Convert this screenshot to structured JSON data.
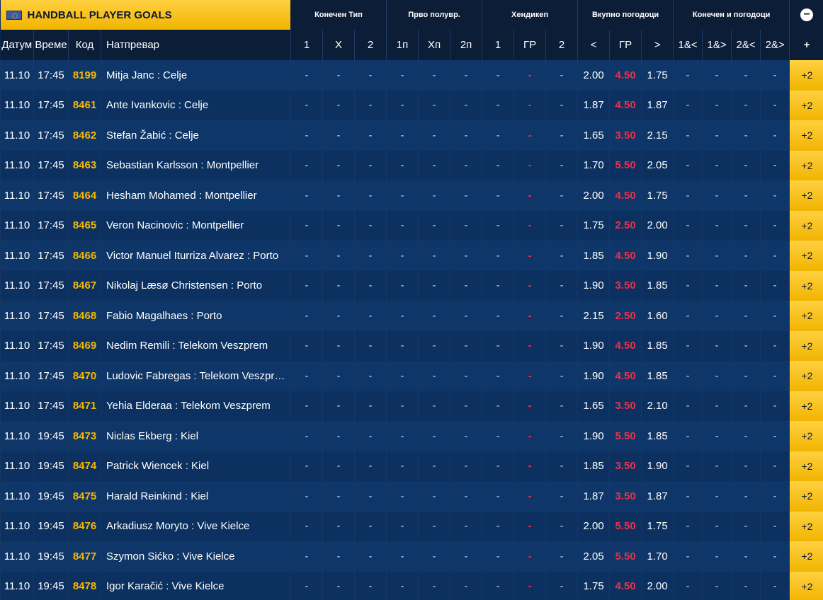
{
  "header": {
    "title": "HANDBALL PLAYER GOALS",
    "groups": [
      "Конечен Тип",
      "Прво полувр.",
      "Хендикеп",
      "Вкупно погодоци",
      "Конечен и погодоци"
    ],
    "collapse_icon": "minus-circle-icon",
    "columns": {
      "date": "Датум",
      "time": "Време",
      "code": "Код",
      "match": "Натпревар",
      "ft": [
        "1",
        "X",
        "2"
      ],
      "ht": [
        "1п",
        "Xп",
        "2п"
      ],
      "hcp": [
        "1",
        "ГР",
        "2"
      ],
      "total": [
        "<",
        "ГР",
        ">"
      ],
      "combo": [
        "1&<",
        "1&>",
        "2&<",
        "2&>"
      ],
      "plus": "+"
    }
  },
  "colors": {
    "accent": "#f5b800",
    "handicap_value": "#e8324a",
    "background": "#0b2a55"
  },
  "rows": [
    {
      "date": "11.10",
      "time": "17:45",
      "code": "8199",
      "match": "Mitja Janc : Celje",
      "ft": [
        "-",
        "-",
        "-"
      ],
      "ht": [
        "-",
        "-",
        "-"
      ],
      "hcp": [
        "-",
        "-",
        "-"
      ],
      "under": "2.00",
      "gr": "4.50",
      "over": "1.75",
      "combo": [
        "-",
        "-",
        "-",
        "-"
      ],
      "more": "+2"
    },
    {
      "date": "11.10",
      "time": "17:45",
      "code": "8461",
      "match": "Ante Ivankovic : Celje",
      "ft": [
        "-",
        "-",
        "-"
      ],
      "ht": [
        "-",
        "-",
        "-"
      ],
      "hcp": [
        "-",
        "-",
        "-"
      ],
      "under": "1.87",
      "gr": "4.50",
      "over": "1.87",
      "combo": [
        "-",
        "-",
        "-",
        "-"
      ],
      "more": "+2"
    },
    {
      "date": "11.10",
      "time": "17:45",
      "code": "8462",
      "match": "Stefan Žabić : Celje",
      "ft": [
        "-",
        "-",
        "-"
      ],
      "ht": [
        "-",
        "-",
        "-"
      ],
      "hcp": [
        "-",
        "-",
        "-"
      ],
      "under": "1.65",
      "gr": "3.50",
      "over": "2.15",
      "combo": [
        "-",
        "-",
        "-",
        "-"
      ],
      "more": "+2"
    },
    {
      "date": "11.10",
      "time": "17:45",
      "code": "8463",
      "match": "Sebastian Karlsson : Montpellier",
      "ft": [
        "-",
        "-",
        "-"
      ],
      "ht": [
        "-",
        "-",
        "-"
      ],
      "hcp": [
        "-",
        "-",
        "-"
      ],
      "under": "1.70",
      "gr": "5.50",
      "over": "2.05",
      "combo": [
        "-",
        "-",
        "-",
        "-"
      ],
      "more": "+2"
    },
    {
      "date": "11.10",
      "time": "17:45",
      "code": "8464",
      "match": "Hesham Mohamed : Montpellier",
      "ft": [
        "-",
        "-",
        "-"
      ],
      "ht": [
        "-",
        "-",
        "-"
      ],
      "hcp": [
        "-",
        "-",
        "-"
      ],
      "under": "2.00",
      "gr": "4.50",
      "over": "1.75",
      "combo": [
        "-",
        "-",
        "-",
        "-"
      ],
      "more": "+2"
    },
    {
      "date": "11.10",
      "time": "17:45",
      "code": "8465",
      "match": "Veron Nacinovic : Montpellier",
      "ft": [
        "-",
        "-",
        "-"
      ],
      "ht": [
        "-",
        "-",
        "-"
      ],
      "hcp": [
        "-",
        "-",
        "-"
      ],
      "under": "1.75",
      "gr": "2.50",
      "over": "2.00",
      "combo": [
        "-",
        "-",
        "-",
        "-"
      ],
      "more": "+2"
    },
    {
      "date": "11.10",
      "time": "17:45",
      "code": "8466",
      "match": "Victor Manuel Iturriza Alvarez : Porto",
      "ft": [
        "-",
        "-",
        "-"
      ],
      "ht": [
        "-",
        "-",
        "-"
      ],
      "hcp": [
        "-",
        "-",
        "-"
      ],
      "under": "1.85",
      "gr": "4.50",
      "over": "1.90",
      "combo": [
        "-",
        "-",
        "-",
        "-"
      ],
      "more": "+2"
    },
    {
      "date": "11.10",
      "time": "17:45",
      "code": "8467",
      "match": "Nikolaj Læsø Christensen : Porto",
      "ft": [
        "-",
        "-",
        "-"
      ],
      "ht": [
        "-",
        "-",
        "-"
      ],
      "hcp": [
        "-",
        "-",
        "-"
      ],
      "under": "1.90",
      "gr": "3.50",
      "over": "1.85",
      "combo": [
        "-",
        "-",
        "-",
        "-"
      ],
      "more": "+2"
    },
    {
      "date": "11.10",
      "time": "17:45",
      "code": "8468",
      "match": "Fabio Magalhaes : Porto",
      "ft": [
        "-",
        "-",
        "-"
      ],
      "ht": [
        "-",
        "-",
        "-"
      ],
      "hcp": [
        "-",
        "-",
        "-"
      ],
      "under": "2.15",
      "gr": "2.50",
      "over": "1.60",
      "combo": [
        "-",
        "-",
        "-",
        "-"
      ],
      "more": "+2"
    },
    {
      "date": "11.10",
      "time": "17:45",
      "code": "8469",
      "match": "Nedim Remili : Telekom Veszprem",
      "ft": [
        "-",
        "-",
        "-"
      ],
      "ht": [
        "-",
        "-",
        "-"
      ],
      "hcp": [
        "-",
        "-",
        "-"
      ],
      "under": "1.90",
      "gr": "4.50",
      "over": "1.85",
      "combo": [
        "-",
        "-",
        "-",
        "-"
      ],
      "more": "+2"
    },
    {
      "date": "11.10",
      "time": "17:45",
      "code": "8470",
      "match": "Ludovic Fabregas : Telekom Veszpr…",
      "ft": [
        "-",
        "-",
        "-"
      ],
      "ht": [
        "-",
        "-",
        "-"
      ],
      "hcp": [
        "-",
        "-",
        "-"
      ],
      "under": "1.90",
      "gr": "4.50",
      "over": "1.85",
      "combo": [
        "-",
        "-",
        "-",
        "-"
      ],
      "more": "+2"
    },
    {
      "date": "11.10",
      "time": "17:45",
      "code": "8471",
      "match": "Yehia Elderaa : Telekom Veszprem",
      "ft": [
        "-",
        "-",
        "-"
      ],
      "ht": [
        "-",
        "-",
        "-"
      ],
      "hcp": [
        "-",
        "-",
        "-"
      ],
      "under": "1.65",
      "gr": "3.50",
      "over": "2.10",
      "combo": [
        "-",
        "-",
        "-",
        "-"
      ],
      "more": "+2"
    },
    {
      "date": "11.10",
      "time": "19:45",
      "code": "8473",
      "match": "Niclas Ekberg : Kiel",
      "ft": [
        "-",
        "-",
        "-"
      ],
      "ht": [
        "-",
        "-",
        "-"
      ],
      "hcp": [
        "-",
        "-",
        "-"
      ],
      "under": "1.90",
      "gr": "5.50",
      "over": "1.85",
      "combo": [
        "-",
        "-",
        "-",
        "-"
      ],
      "more": "+2"
    },
    {
      "date": "11.10",
      "time": "19:45",
      "code": "8474",
      "match": "Patrick Wiencek : Kiel",
      "ft": [
        "-",
        "-",
        "-"
      ],
      "ht": [
        "-",
        "-",
        "-"
      ],
      "hcp": [
        "-",
        "-",
        "-"
      ],
      "under": "1.85",
      "gr": "3.50",
      "over": "1.90",
      "combo": [
        "-",
        "-",
        "-",
        "-"
      ],
      "more": "+2"
    },
    {
      "date": "11.10",
      "time": "19:45",
      "code": "8475",
      "match": "Harald Reinkind : Kiel",
      "ft": [
        "-",
        "-",
        "-"
      ],
      "ht": [
        "-",
        "-",
        "-"
      ],
      "hcp": [
        "-",
        "-",
        "-"
      ],
      "under": "1.87",
      "gr": "3.50",
      "over": "1.87",
      "combo": [
        "-",
        "-",
        "-",
        "-"
      ],
      "more": "+2"
    },
    {
      "date": "11.10",
      "time": "19:45",
      "code": "8476",
      "match": "Arkadiusz Moryto : Vive Kielce",
      "ft": [
        "-",
        "-",
        "-"
      ],
      "ht": [
        "-",
        "-",
        "-"
      ],
      "hcp": [
        "-",
        "-",
        "-"
      ],
      "under": "2.00",
      "gr": "5.50",
      "over": "1.75",
      "combo": [
        "-",
        "-",
        "-",
        "-"
      ],
      "more": "+2"
    },
    {
      "date": "11.10",
      "time": "19:45",
      "code": "8477",
      "match": "Szymon Sićko : Vive Kielce",
      "ft": [
        "-",
        "-",
        "-"
      ],
      "ht": [
        "-",
        "-",
        "-"
      ],
      "hcp": [
        "-",
        "-",
        "-"
      ],
      "under": "2.05",
      "gr": "5.50",
      "over": "1.70",
      "combo": [
        "-",
        "-",
        "-",
        "-"
      ],
      "more": "+2"
    },
    {
      "date": "11.10",
      "time": "19:45",
      "code": "8478",
      "match": "Igor Karačić : Vive Kielce",
      "ft": [
        "-",
        "-",
        "-"
      ],
      "ht": [
        "-",
        "-",
        "-"
      ],
      "hcp": [
        "-",
        "-",
        "-"
      ],
      "under": "1.75",
      "gr": "4.50",
      "over": "2.00",
      "combo": [
        "-",
        "-",
        "-",
        "-"
      ],
      "more": "+2"
    }
  ]
}
